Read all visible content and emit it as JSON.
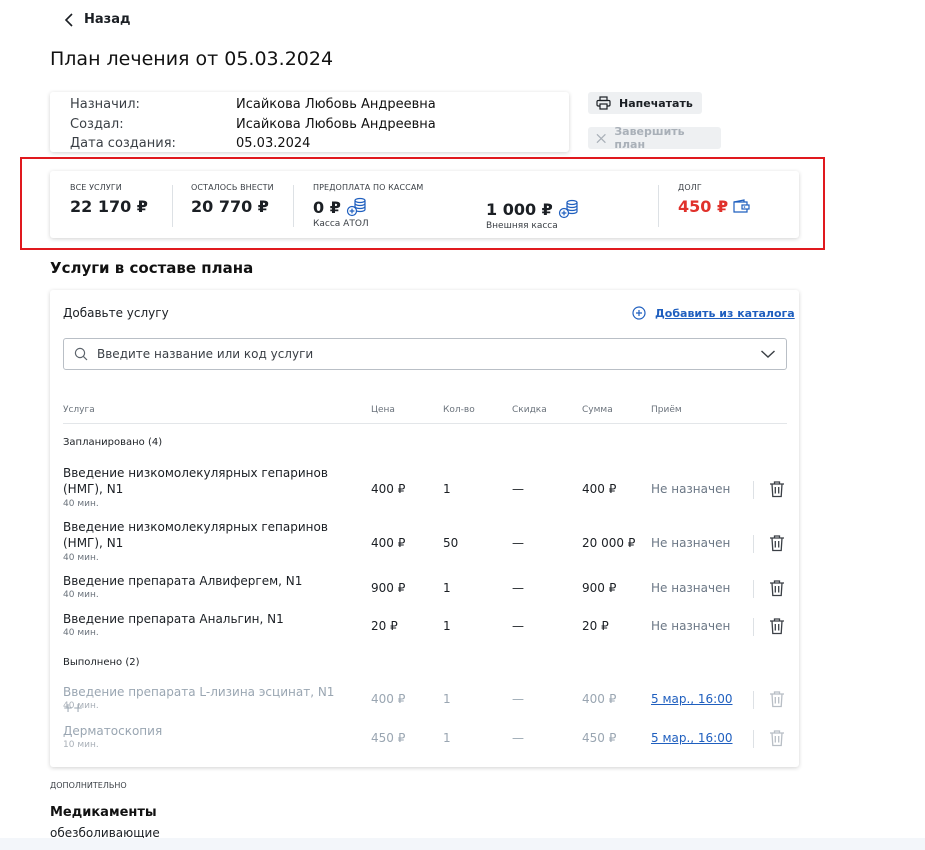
{
  "header": {
    "back_label": "Назад",
    "title": "План лечения от 05.03.2024"
  },
  "info": [
    {
      "label": "Назначил:",
      "value": "Исайкова Любовь Андреевна"
    },
    {
      "label": "Создал:",
      "value": "Исайкова Любовь Андреевна"
    },
    {
      "label": "Дата создания:",
      "value": "05.03.2024"
    }
  ],
  "actions": {
    "print_label": "Напечатать",
    "finish_label": "Завершить план"
  },
  "summary": {
    "all_caption": "ВСЕ УСЛУГИ",
    "all_value": "22 170 ₽",
    "left_caption": "ОСТАЛОСЬ ВНЕСТИ",
    "left_value": "20 770 ₽",
    "prepay_caption": "ПРЕДОПЛАТА ПО КАССАМ",
    "kassa1_value": "0 ₽",
    "kassa1_name": "Касса АТОЛ",
    "kassa2_value": "1 000 ₽",
    "kassa2_name": "Внешняя касса",
    "debt_caption": "ДОЛГ",
    "debt_value": "450 ₽",
    "debt_color": "#e0312b"
  },
  "services": {
    "section_title": "Услуги в составе плана",
    "add_label": "Добавьте услугу",
    "catalog_link": "Добавить из каталога",
    "search_placeholder": "Введите название или код услуги",
    "columns": {
      "service": "Услуга",
      "price": "Цена",
      "qty": "Кол-во",
      "discount": "Скидка",
      "sum": "Сумма",
      "appointment": "Приём"
    },
    "planned_title": "Запланировано (4)",
    "done_title": "Выполнено (2)",
    "planned": [
      {
        "name": "Введение низкомолекулярных гепаринов (НМГ), N1",
        "duration": "40 мин.",
        "price": "400 ₽",
        "qty": "1",
        "discount": "—",
        "sum": "400 ₽",
        "status": "Не назначен"
      },
      {
        "name": "Введение низкомолекулярных гепаринов (НМГ), N1",
        "duration": "40 мин.",
        "price": "400 ₽",
        "qty": "50",
        "discount": "—",
        "sum": "20 000 ₽",
        "status": "Не назначен"
      },
      {
        "name": "Введение препарата Алвифергем, N1",
        "duration": "40 мин.",
        "price": "900 ₽",
        "qty": "1",
        "discount": "—",
        "sum": "900 ₽",
        "status": "Не назначен"
      },
      {
        "name": "Введение препарата Анальгин, N1",
        "duration": "40 мин.",
        "price": "20 ₽",
        "qty": "1",
        "discount": "—",
        "sum": "20 ₽",
        "status": "Не назначен"
      }
    ],
    "done": [
      {
        "name": "Введение препарата L-лизина эсцинат, N1 ++",
        "duration": "40 мин.",
        "price": "400 ₽",
        "qty": "1",
        "discount": "—",
        "sum": "400 ₽",
        "status": "5 мар., 16:00"
      },
      {
        "name": "Дерматоскопия",
        "duration": "10 мин.",
        "price": "450 ₽",
        "qty": "1",
        "discount": "—",
        "sum": "450 ₽",
        "status": "5 мар., 16:00"
      }
    ]
  },
  "extra": {
    "caption": "ДОПОЛНИТЕЛЬНО",
    "meds_title": "Медикаменты",
    "meds_item": "обезболивающие"
  },
  "icons": {
    "back": "chevron-left-icon",
    "print": "printer-icon",
    "finish": "close-icon",
    "coins": "coins-add-icon",
    "wallet": "wallet-icon",
    "add": "plus-circle-icon",
    "search": "search-icon",
    "dropdown": "chevron-down-icon",
    "delete": "trash-icon"
  },
  "colors": {
    "accent": "#1f5fbf",
    "highlight_frame": "#e0191e"
  }
}
